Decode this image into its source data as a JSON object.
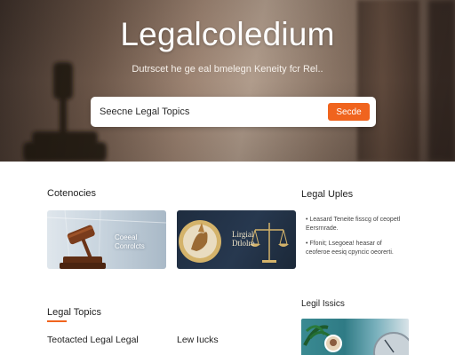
{
  "hero": {
    "title": "Legalcoledium",
    "subtitle": "Dutrscet he ge eal bmelegn Keneity fcr Rel..",
    "search": {
      "placeholder": "Seecne Legal Topics",
      "button_label": "Secde"
    }
  },
  "categories": {
    "heading": "Cotenocies",
    "cards": [
      {
        "label_line1": "Coeeal",
        "label_line2": "Conrolcts"
      },
      {
        "label_line1": "Lirgial",
        "label_line2": "Dtlolre"
      }
    ]
  },
  "sidebar_topics": {
    "heading": "Legal Uples",
    "items": [
      {
        "text": "• Leasard Teneite fisscg of ceopetl Eersrnrade."
      },
      {
        "text": "• Ffonit; Lsegoea! heasar of ceoferoe eesiq cpyncic oeorerti."
      }
    ]
  },
  "legal_topics": {
    "heading": "Legal Topics",
    "col1_title": "Teotacted Legal Legal",
    "col2_title": "Lew Iucks"
  },
  "legal_issues": {
    "heading": "Legil Issics"
  },
  "colors": {
    "accent": "#f0641e",
    "hero_tint": "#8e7868",
    "card_dark": "#1e2c3f"
  }
}
